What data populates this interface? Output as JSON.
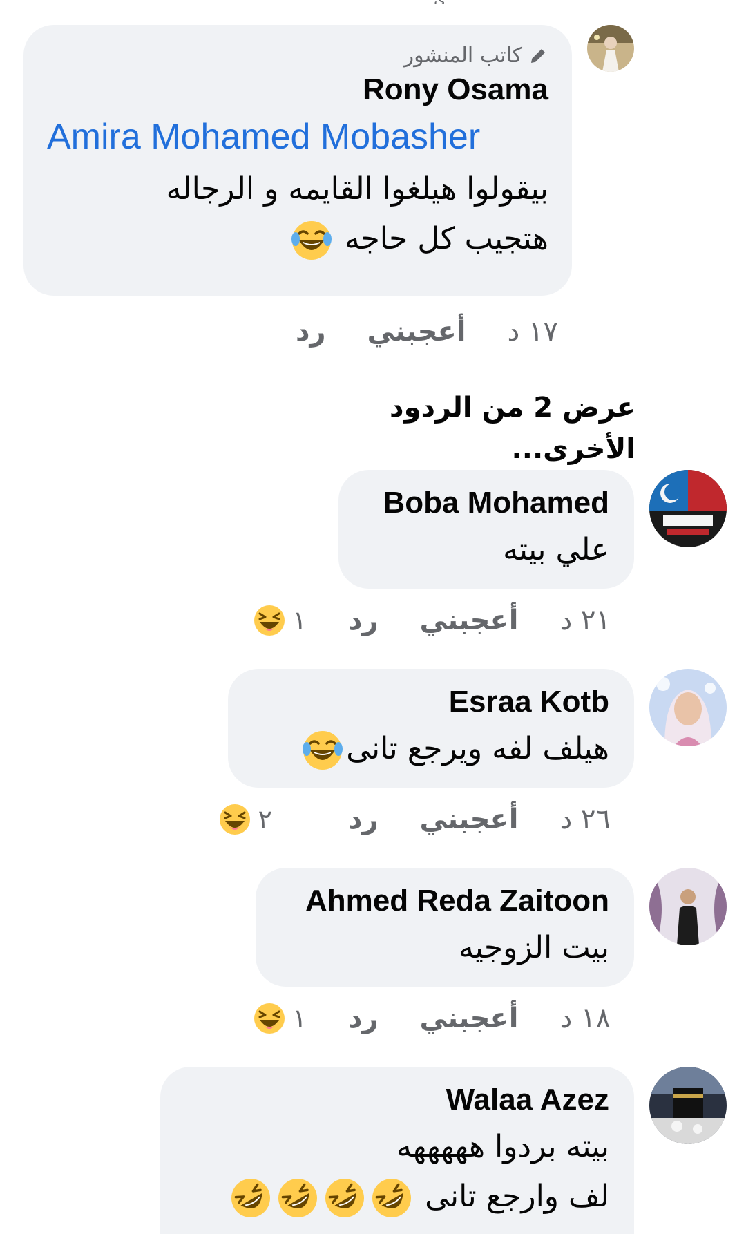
{
  "colors": {
    "bubble_bg": "#f0f2f5",
    "mention_blue": "#216fdb",
    "secondary_text": "#65676b",
    "emoji_yellow": "#ffcc4d"
  },
  "top_sliver": "ي",
  "comments": [
    {
      "author_badge": "كاتب المنشور",
      "author_badge_icon": "pencil-icon",
      "name": "Rony Osama",
      "mention": "Amira Mohamed Mobasher",
      "lines": [
        "بيقولوا هيلغوا القايمه و الرجاله",
        "هتجيب كل حاجه"
      ],
      "time": "١٧ د",
      "like": "أعجبني",
      "reply": "رد"
    }
  ],
  "more_replies": "عرض 2 من الردود الأخرى...",
  "replies": [
    {
      "name": "Boba Mohamed",
      "lines": [
        "علي بيته"
      ],
      "time": "٢١ د",
      "like": "أعجبني",
      "reply": "رد",
      "reaction_icon": "laughing-squint-emoji-icon",
      "reaction_count": "١"
    },
    {
      "name": "Esraa Kotb",
      "lines": [
        "هيلف لفه ويرجع تانى"
      ],
      "time": "٢٦ د",
      "like": "أعجبني",
      "reply": "رد",
      "reaction_icon": "laughing-squint-emoji-icon",
      "reaction_count": "٢"
    },
    {
      "name": "Ahmed Reda Zaitoon",
      "lines": [
        "بيت الزوجيه"
      ],
      "time": "١٨ د",
      "like": "أعجبني",
      "reply": "رد",
      "reaction_icon": "laughing-squint-emoji-icon",
      "reaction_count": "١"
    },
    {
      "name": "Walaa Azez",
      "lines": [
        "بيته بردوا هههههه",
        "لف وارجع تانى"
      ]
    }
  ]
}
